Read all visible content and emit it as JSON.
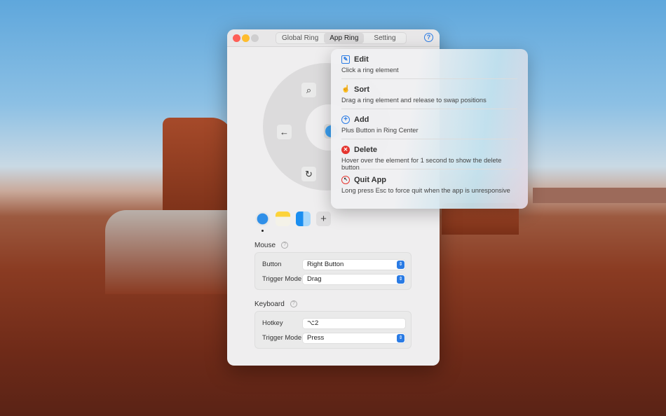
{
  "window": {
    "tabs": [
      "Global Ring",
      "App Ring",
      "Setting"
    ],
    "active_tab": "App Ring",
    "help_icon": "question-circle-icon"
  },
  "ring": {
    "elements": [
      "search-icon",
      "arrow-left-icon",
      "refresh-icon"
    ],
    "center_app": "safari-icon"
  },
  "apps": [
    "safari-icon",
    "notes-icon",
    "finder-icon"
  ],
  "add_label": "+",
  "mouse": {
    "title": "Mouse",
    "button_label": "Button",
    "button_value": "Right Button",
    "trigger_label": "Trigger Mode",
    "trigger_value": "Drag"
  },
  "keyboard": {
    "title": "Keyboard",
    "hotkey_label": "Hotkey",
    "hotkey_value": "⌥2",
    "trigger_label": "Trigger Mode",
    "trigger_value": "Press"
  },
  "help_popover": {
    "items": [
      {
        "title": "Edit",
        "desc": "Click a ring element",
        "icon": "edit-icon"
      },
      {
        "title": "Sort",
        "desc": "Drag a ring element and release to swap positions",
        "icon": "hand-drag-icon"
      },
      {
        "title": "Add",
        "desc": "Plus Button in Ring Center",
        "icon": "plus-circle-icon"
      },
      {
        "title": "Delete",
        "desc": "Hover over the element for 1 second to show the delete button",
        "icon": "x-circle-icon"
      },
      {
        "title": "Quit App",
        "desc": "Long press Esc to force quit when the app is unresponsive",
        "icon": "force-quit-icon"
      }
    ]
  },
  "colors": {
    "accent": "#2a7be4",
    "delete": "#e5352f"
  }
}
